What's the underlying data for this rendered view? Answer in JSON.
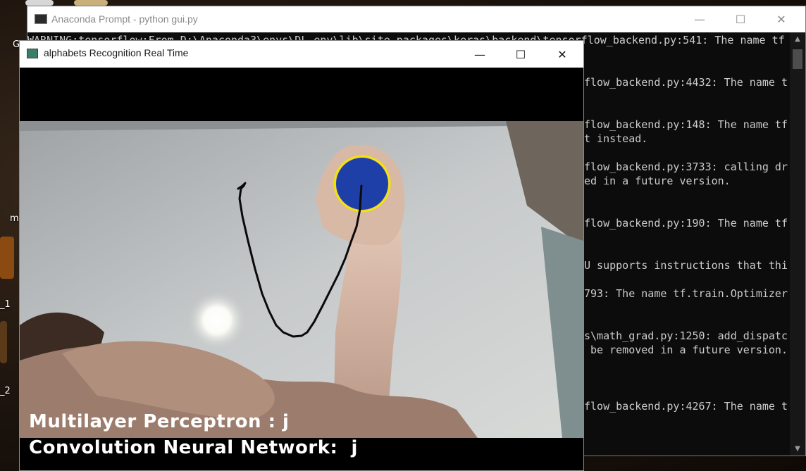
{
  "desktop": {
    "labels": [
      "G",
      "m",
      "_1",
      "_2"
    ]
  },
  "console": {
    "title": "Anaconda Prompt - python  gui.py",
    "minimize_glyph": "—",
    "maximize_glyph": "☐",
    "close_glyph": "✕",
    "lines": [
      "WARNING:tensorflow:From D:\\Anaconda3\\envs\\DL_env\\lib\\site-packages\\keras\\backend\\tensorflow_backend.py:541: The name tf",
      "flow_backend.py:4432: The name t",
      "flow_backend.py:148: The name tf",
      "t instead.",
      "flow_backend.py:3733: calling dr",
      "ed in a future version.",
      "flow_backend.py:190: The name tf",
      "U supports instructions that thi",
      "793: The name tf.train.Optimizer",
      "s\\math_grad.py:1250: add_dispatc",
      " be removed in a future version.",
      "flow_backend.py:4267: The name t"
    ],
    "scroll_up_glyph": "▲",
    "scroll_down_glyph": "▼"
  },
  "recognition_window": {
    "title": "alphabets Recognition Real Time",
    "minimize_glyph": "—",
    "maximize_glyph": "☐",
    "close_glyph": "✕",
    "mlp_label": "Multilayer Perceptron : j",
    "cnn_label": "Convolution Neural Network:  j"
  },
  "colors": {
    "tracker_ring": "#f5e400",
    "blue_marker": "#1f3fa8",
    "drawn_stroke": "#0a0a0a"
  }
}
